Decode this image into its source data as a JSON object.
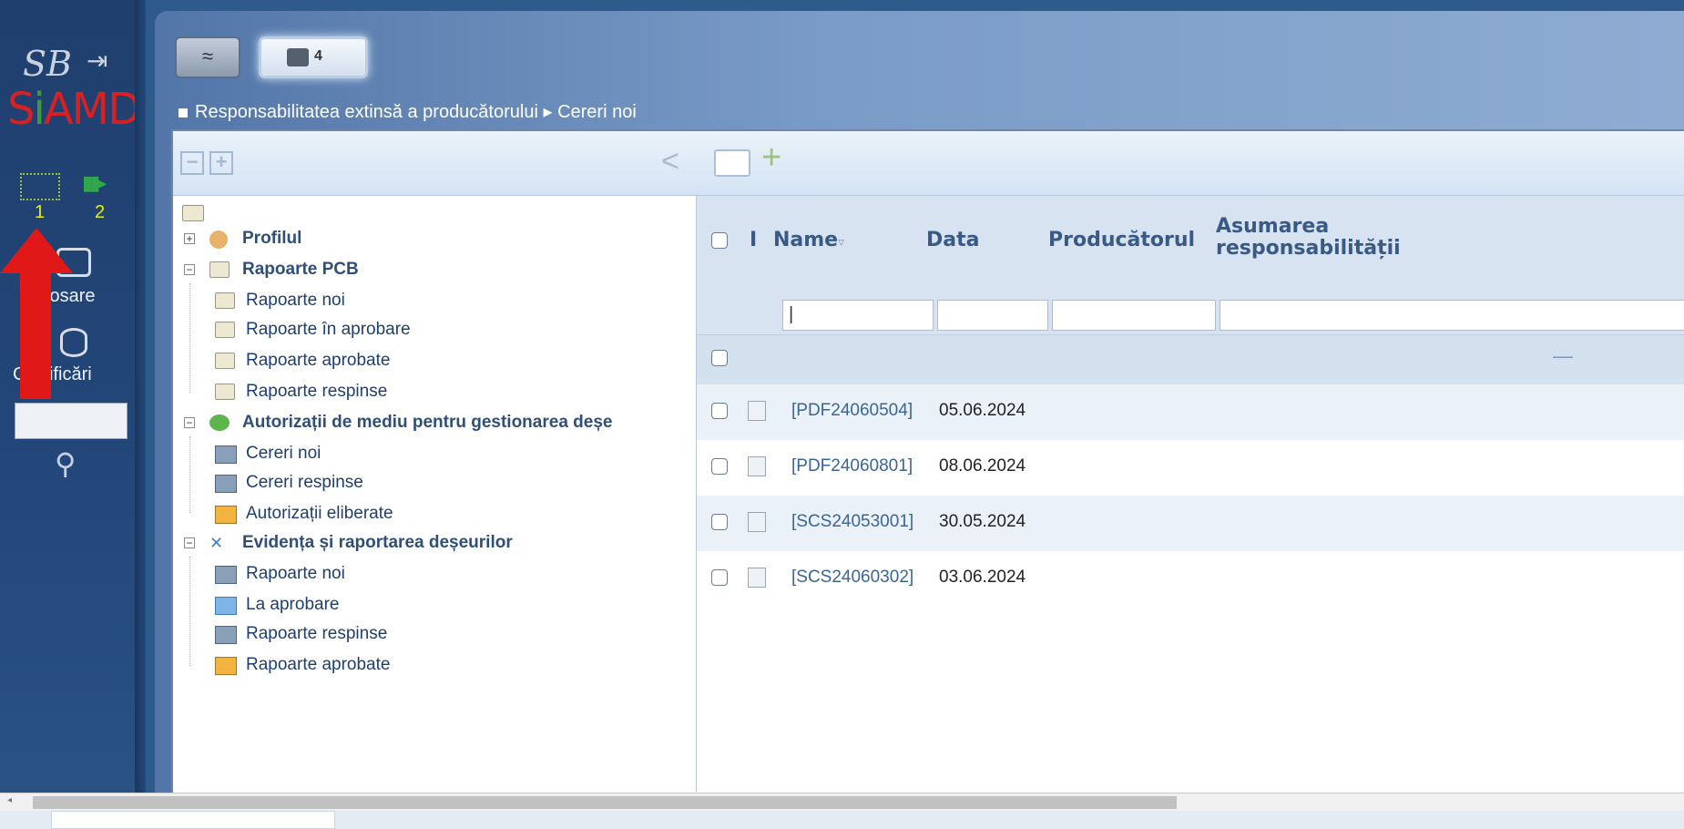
{
  "sidebar": {
    "logo": "SB",
    "brand": "SIAMD",
    "counts": [
      "1",
      "2"
    ],
    "items": [
      {
        "label": "Dosare"
      },
      {
        "label": "Clasificări"
      }
    ]
  },
  "tabs": {
    "collapse_symbol": "≈",
    "tab_count": "4"
  },
  "breadcrumb": {
    "section": "Responsabilitatea extinsă a producătorului",
    "separator": " ▸ ",
    "current": "Cereri noi"
  },
  "toolbar": {
    "collapse": "−",
    "expand": "+",
    "back": "<",
    "add": "+"
  },
  "tree": {
    "groups": [
      {
        "label": "Profilul",
        "children": []
      },
      {
        "label": "Rapoarte PCB",
        "children": [
          "Rapoarte noi",
          "Rapoarte în aprobare",
          "Rapoarte aprobate",
          "Rapoarte respinse"
        ]
      },
      {
        "label": "Autorizații de mediu pentru gestionarea deșe",
        "children": [
          "Cereri noi",
          "Cereri respinse",
          "Autorizații eliberate"
        ]
      },
      {
        "label": "Evidența și raportarea deșeurilor",
        "children": [
          "Rapoarte noi",
          "La aprobare",
          "Rapoarte respinse",
          "Rapoarte aprobate"
        ]
      }
    ]
  },
  "grid": {
    "columns": {
      "i": "I",
      "name": "Name",
      "sort": "▿",
      "data": "Data",
      "producator": "Producătorul",
      "asumarea_line1": "Asumarea",
      "asumarea_line2": "responsabilității"
    },
    "filter_value": "|",
    "group_dash": "—",
    "rows": [
      {
        "name": "[PDF24060504]",
        "date": "05.06.2024"
      },
      {
        "name": "[PDF24060801]",
        "date": "08.06.2024"
      },
      {
        "name": "[SCS24053001]",
        "date": "30.05.2024"
      },
      {
        "name": "[SCS24060302]",
        "date": "03.06.2024"
      }
    ]
  },
  "colors": {
    "sidebar": "#1f3f6e",
    "header_bg": "#d7e3f0",
    "link": "#3a6597",
    "arrow": "#e01818"
  }
}
